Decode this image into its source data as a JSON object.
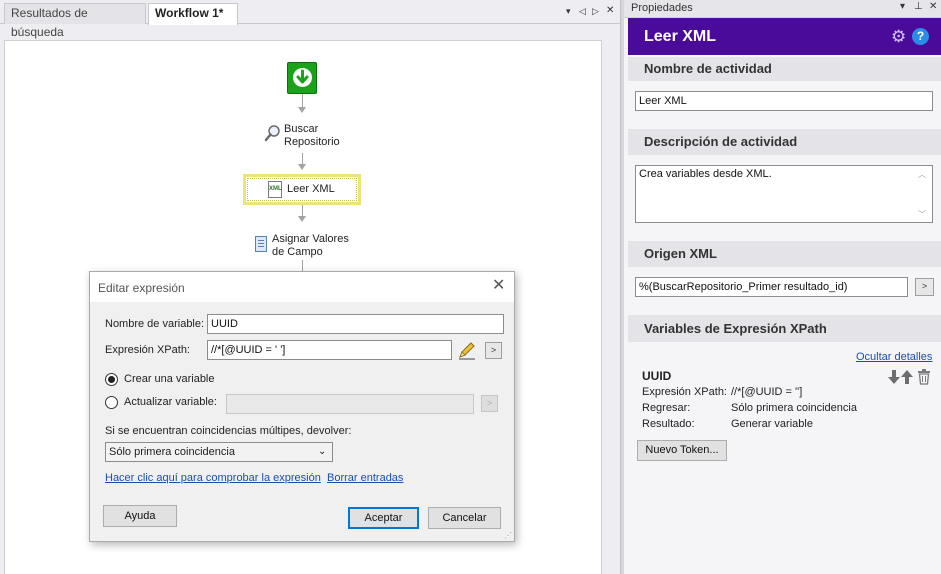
{
  "tabs": {
    "search_results": "Resultados de búsqueda",
    "workflow": "Workflow 1*"
  },
  "tab_controls": {
    "dropdown": "▾",
    "left": "◁",
    "right": "▷",
    "close": "✕"
  },
  "workflow": {
    "nodes": [
      {
        "label": "Buscar\nRepositorio",
        "icon": "magnifier-icon"
      },
      {
        "label": "Leer XML",
        "icon": "xml-file-icon"
      },
      {
        "label": "Asignar Valores\nde Campo",
        "icon": "document-list-icon"
      }
    ],
    "start_icon": "download-arrow-icon",
    "xml_badge": "XML"
  },
  "dialog": {
    "title": "Editar expresión",
    "close": "✕",
    "variable_name_label": "Nombre de variable:",
    "variable_name_value": "UUID",
    "xpath_label": "Expresión XPath:",
    "xpath_value": "//*[@UUID = ' ']",
    "create_variable_label": "Crear una variable",
    "update_variable_label": "Actualizar variable:",
    "multiple_matches_label": "Si se encuentran coincidencias múltipes, devolver:",
    "return_option": "Sólo primera coincidencia",
    "test_link": "Hacer clic aquí para comprobar la expresión",
    "clear_link": "Borrar entradas",
    "help_button": "Ayuda",
    "accept_button": "Aceptar",
    "cancel_button": "Cancelar",
    "arrow_button": ">",
    "selected_radio": "create"
  },
  "properties": {
    "panel_title": "Propiedades",
    "header_title": "Leer XML",
    "activity_name_section": "Nombre de actividad",
    "activity_name_value": "Leer XML",
    "activity_description_section": "Descripción de actividad",
    "activity_description_value": "Crea variables desde XML.",
    "xml_source_section": "Origen XML",
    "xml_source_value": "%(BuscarRepositorio_Primer resultado_id)",
    "xml_source_button": ">",
    "xpath_variables_section": "Variables de Expresión XPath",
    "hide_details_link": "Ocultar detalles",
    "variable": {
      "name": "UUID",
      "xpath_label": "Expresión XPath:",
      "xpath_value": "//*[@UUID = '']",
      "return_label": "Regresar:",
      "return_value": "Sólo primera coincidencia",
      "result_label": "Resultado:",
      "result_value": "Generar variable"
    },
    "new_token_button": "Nuevo Token..."
  },
  "colors": {
    "header_purple": "#4b0b9a",
    "start_green": "#1aa31a",
    "selection_yellow": "#ece37a",
    "link_blue": "#1a4eb3",
    "help_blue": "#2b8ce8"
  }
}
